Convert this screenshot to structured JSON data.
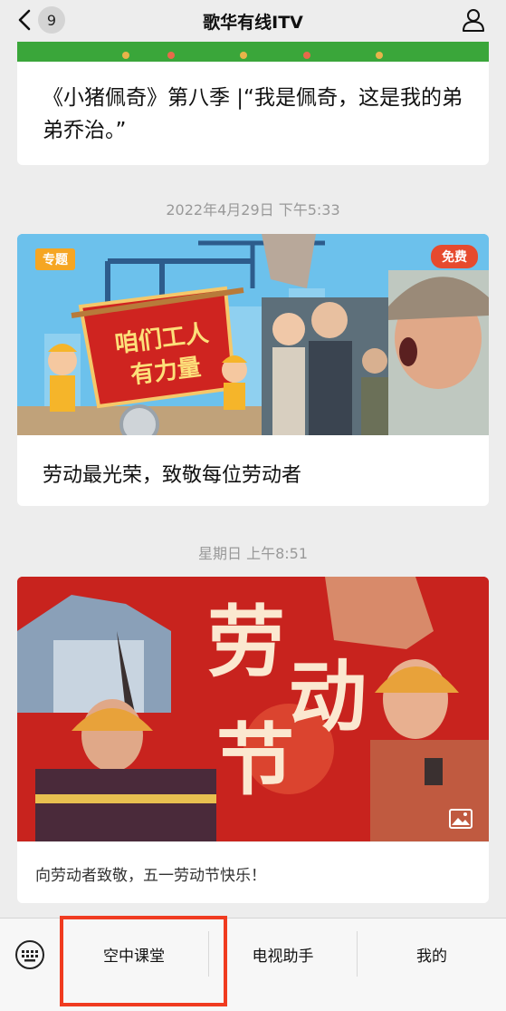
{
  "nav": {
    "back_count": "9",
    "title": "歌华有线ITV"
  },
  "feed": {
    "card1_text": "《小猪佩奇》第八季 |“我是佩奇，这是我的弟弟乔治。”",
    "time1": "2022年4月29日 下午5:33",
    "card2": {
      "tag": "专题",
      "badge": "免费",
      "banner_line1": "咱们工人",
      "banner_line2": "有力量",
      "title": "劳动最光荣，致敬每位劳动者"
    },
    "time2": "星期日 上午8:51",
    "card3": {
      "art_chars": [
        "劳",
        "动",
        "节"
      ],
      "title": "向劳动者致敬，五一劳动节快乐！"
    }
  },
  "menu": {
    "items": [
      "空中课堂",
      "电视助手",
      "我的"
    ]
  },
  "colors": {
    "highlight": "#f03b20",
    "banner_red": "#c8231e",
    "banner_blue": "#5fb9e8",
    "stripe_green": "#3aa63a"
  },
  "icons": [
    "chevron-left-icon",
    "user-icon",
    "keyboard-icon",
    "image-icon"
  ]
}
